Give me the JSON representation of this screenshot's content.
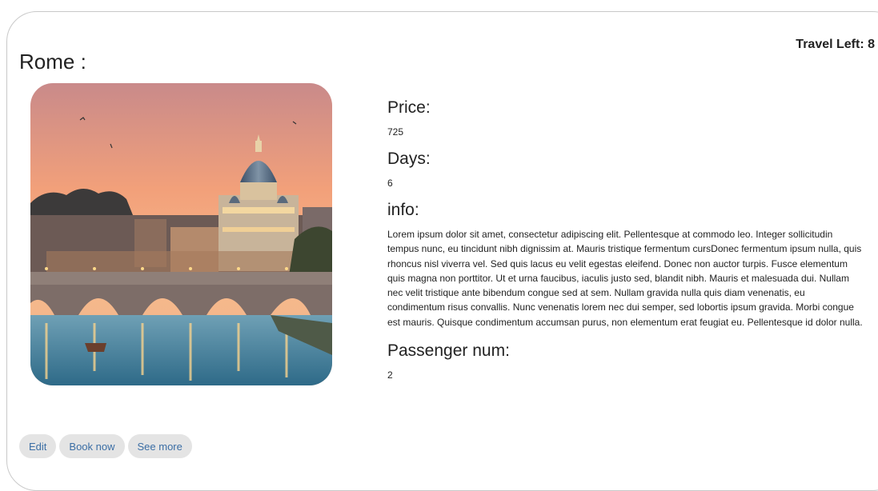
{
  "header": {
    "travel_left_label": "Travel Left: 8"
  },
  "destination": {
    "title": "Rome :",
    "price_label": "Price:",
    "price_value": "725",
    "days_label": "Days:",
    "days_value": "6",
    "info_label": "info:",
    "info_text": "Lorem ipsum dolor sit amet, consectetur adipiscing elit. Pellentesque at commodo leo. Integer sollicitudin tempus nunc, eu tincidunt nibh dignissim at. Mauris tristique fermentum cursDonec fermentum ipsum nulla, quis rhoncus nisl viverra vel. Sed quis lacus eu velit egestas eleifend. Donec non auctor turpis. Fusce elementum quis magna non porttitor. Ut et urna faucibus, iaculis justo sed, blandit nibh. Mauris et malesuada dui. Nullam nec velit tristique ante bibendum congue sed at sem. Nullam gravida nulla quis diam venenatis, eu condimentum risus convallis. Nunc venenatis lorem nec dui semper, sed lobortis ipsum gravida. Morbi congue est mauris. Quisque condimentum accumsan purus, non elementum erat feugiat eu. Pellentesque id dolor nulla.",
    "passenger_label": "Passenger num:",
    "passenger_value": "2"
  },
  "actions": {
    "edit_label": "Edit",
    "book_label": "Book now",
    "see_more_label": "See more"
  },
  "colors": {
    "button_bg": "#e4e4e4",
    "button_text": "#3b6ea5",
    "card_border": "#c9c9c9"
  }
}
